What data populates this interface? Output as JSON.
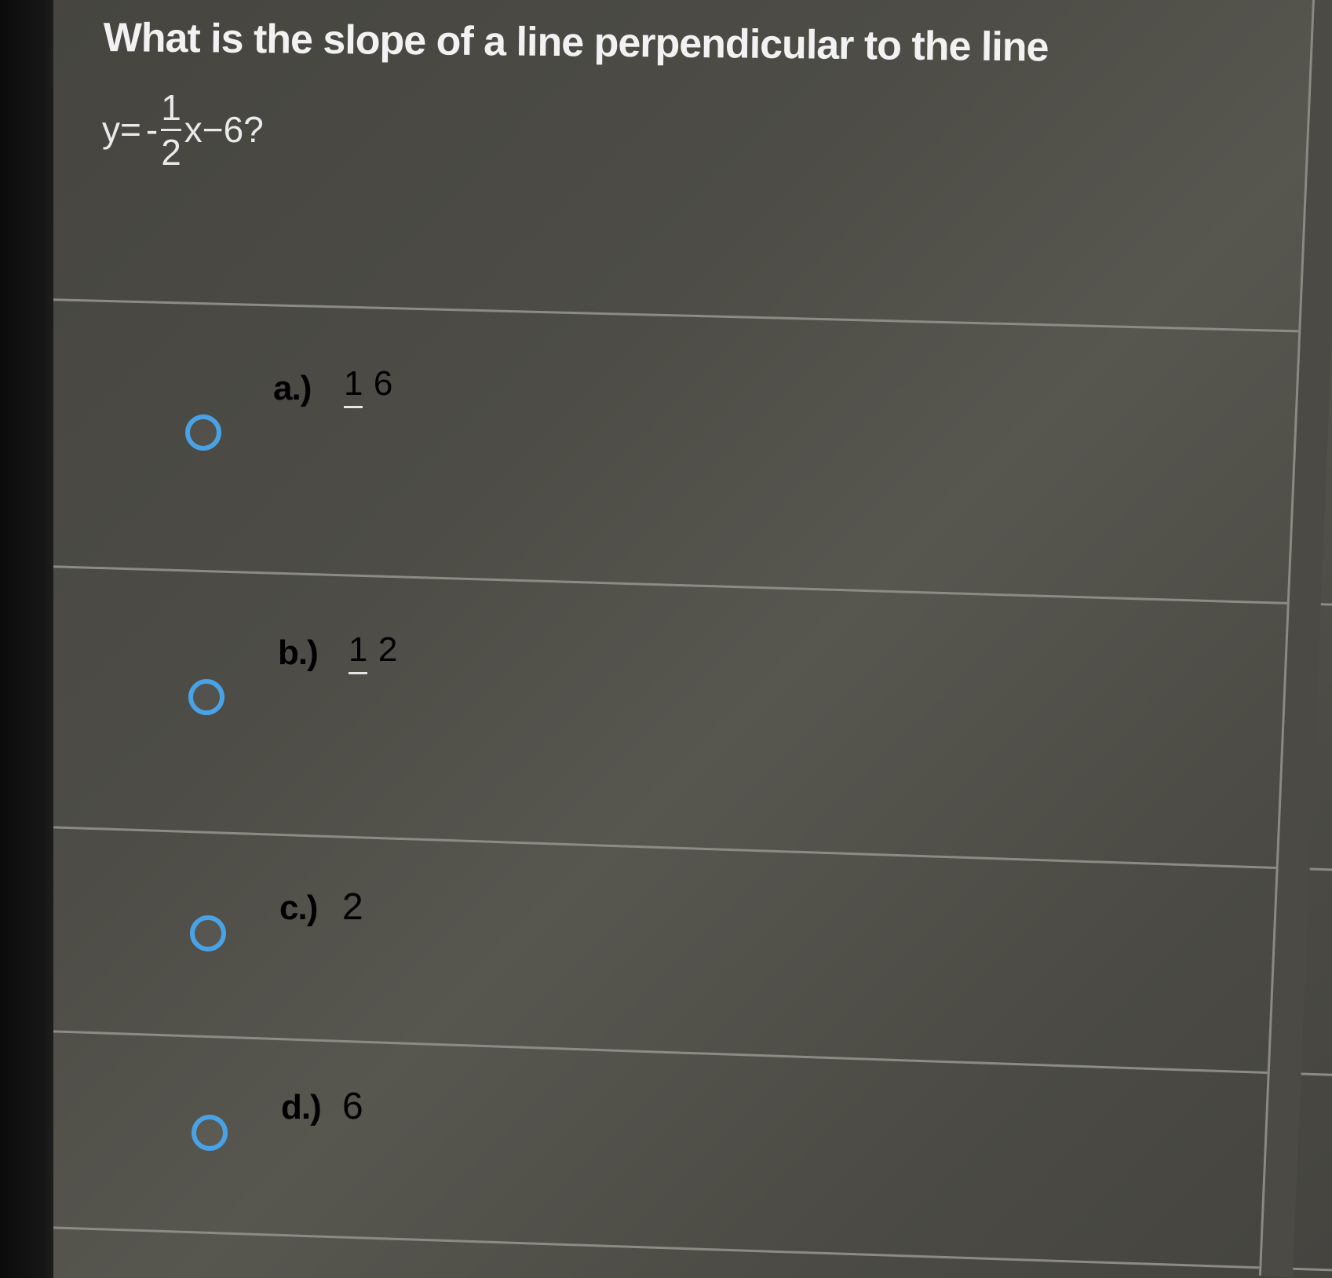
{
  "question": {
    "text": "What is the slope of a line perpendicular to the line",
    "equation": {
      "lhs": "y=",
      "sign": "-",
      "numerator": "1",
      "denominator": "2",
      "rest": "x−6?"
    }
  },
  "options": [
    {
      "letter": "a.)",
      "type": "fraction",
      "numerator": "1",
      "denominator": "6"
    },
    {
      "letter": "b.)",
      "type": "fraction",
      "numerator": "1",
      "denominator": "2"
    },
    {
      "letter": "c.)",
      "type": "number",
      "value": "2"
    },
    {
      "letter": "d.)",
      "type": "number",
      "value": "6"
    }
  ],
  "colors": {
    "radio_accent": "#4aa2e6",
    "background": "#4d4c46",
    "text": "#f0f0f0"
  },
  "icons": {
    "radio": "radio-button-unselected-icon"
  }
}
